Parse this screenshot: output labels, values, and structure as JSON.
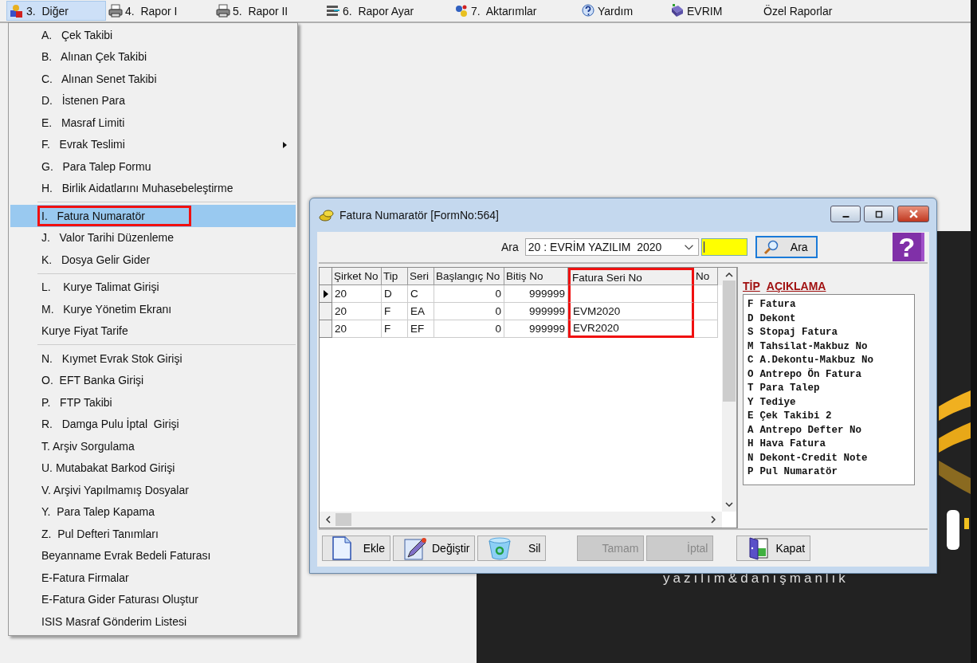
{
  "menubar": [
    {
      "label": "3.  Diğer",
      "selected": true
    },
    {
      "label": "4.  Rapor I",
      "selected": false
    },
    {
      "label": "5.  Rapor II",
      "selected": false
    },
    {
      "label": "6.  Rapor Ayar",
      "selected": false
    },
    {
      "label": "7.  Aktarımlar",
      "selected": false
    },
    {
      "label": "Yardım",
      "selected": false
    },
    {
      "label": "EVRIM",
      "selected": false
    },
    {
      "label": "Özel Raporlar",
      "selected": false
    }
  ],
  "dropdown": {
    "groups": [
      [
        {
          "label": "A.   Çek Takibi",
          "submenu": false,
          "selected": false
        },
        {
          "label": "B.   Alınan Çek Takibi",
          "submenu": false,
          "selected": false
        },
        {
          "label": "C.   Alınan Senet Takibi",
          "submenu": false,
          "selected": false
        },
        {
          "label": "D.   İstenen Para",
          "submenu": false,
          "selected": false
        },
        {
          "label": "E.   Masraf Limiti",
          "submenu": false,
          "selected": false
        },
        {
          "label": "F.   Evrak Teslimi",
          "submenu": true,
          "selected": false
        },
        {
          "label": "G.   Para Talep Formu",
          "submenu": false,
          "selected": false
        },
        {
          "label": "H.   Birlik Aidatlarını Muhasebeleştirme",
          "submenu": false,
          "selected": false
        }
      ],
      [
        {
          "label": "I.   Fatura Numaratör",
          "submenu": false,
          "selected": true
        },
        {
          "label": "J.   Valor Tarihi Düzenleme",
          "submenu": false,
          "selected": false
        },
        {
          "label": "K.   Dosya Gelir Gider",
          "submenu": false,
          "selected": false
        }
      ],
      [
        {
          "label": "L.    Kurye Talimat Girişi",
          "submenu": false,
          "selected": false
        },
        {
          "label": "M.   Kurye Yönetim Ekranı",
          "submenu": false,
          "selected": false
        },
        {
          "label": "Kurye Fiyat Tarife",
          "submenu": false,
          "selected": false
        }
      ],
      [
        {
          "label": "N.   Kıymet Evrak Stok Girişi",
          "submenu": false,
          "selected": false
        },
        {
          "label": "O.  EFT Banka Girişi",
          "submenu": false,
          "selected": false
        },
        {
          "label": "P.   FTP Takibi",
          "submenu": false,
          "selected": false
        },
        {
          "label": "R.   Damga Pulu İptal  Girişi",
          "submenu": false,
          "selected": false
        },
        {
          "label": "T. Arşiv Sorgulama",
          "submenu": false,
          "selected": false
        },
        {
          "label": "U. Mutabakat Barkod Girişi",
          "submenu": false,
          "selected": false
        },
        {
          "label": "V. Arşivi Yapılmamış Dosyalar",
          "submenu": false,
          "selected": false
        },
        {
          "label": "Y.  Para Talep Kapama",
          "submenu": false,
          "selected": false
        },
        {
          "label": "Z.  Pul Defteri Tanımları",
          "submenu": false,
          "selected": false
        },
        {
          "label": "Beyanname Evrak Bedeli Faturası",
          "submenu": false,
          "selected": false
        },
        {
          "label": "E-Fatura Firmalar",
          "submenu": false,
          "selected": false
        },
        {
          "label": "E-Fatura Gider Faturası Oluştur",
          "submenu": false,
          "selected": false
        },
        {
          "label": "ISIS Masraf Gönderim Listesi",
          "submenu": false,
          "selected": false
        }
      ]
    ]
  },
  "dialog": {
    "title": "Fatura Numaratör [FormNo:564]",
    "search": {
      "label": "Ara",
      "company": "20 : EVRİM YAZILIM  2020",
      "button": "Ara"
    },
    "help_mark": "?",
    "table": {
      "columns": [
        {
          "label": "Şirket No",
          "highlighted": false
        },
        {
          "label": "Tip",
          "highlighted": false
        },
        {
          "label": "Seri",
          "highlighted": false
        },
        {
          "label": "Başlangıç No",
          "highlighted": false
        },
        {
          "label": "Bitiş No",
          "highlighted": false
        },
        {
          "label": "Fatura Seri No",
          "highlighted": true
        },
        {
          "label": "No",
          "highlighted": false
        }
      ],
      "rows": [
        {
          "selected": true,
          "cells": [
            "20",
            "D",
            "C",
            "0",
            "999999",
            "",
            ""
          ]
        },
        {
          "selected": false,
          "cells": [
            "20",
            "F",
            "EA",
            "0",
            "999999",
            "EVM2020",
            ""
          ]
        },
        {
          "selected": false,
          "cells": [
            "20",
            "F",
            "EF",
            "0",
            "999999",
            "EVR2020",
            ""
          ]
        }
      ]
    },
    "legend": {
      "headers": [
        "TİP",
        "AÇIKLAMA"
      ],
      "items": [
        {
          "code": "F",
          "text": "Fatura"
        },
        {
          "code": "D",
          "text": "Dekont"
        },
        {
          "code": "S",
          "text": "Stopaj Fatura"
        },
        {
          "code": "M",
          "text": "Tahsilat-Makbuz No"
        },
        {
          "code": "C",
          "text": "A.Dekontu-Makbuz No"
        },
        {
          "code": "O",
          "text": "Antrepo Ön Fatura"
        },
        {
          "code": "T",
          "text": "Para Talep"
        },
        {
          "code": "Y",
          "text": "Tediye"
        },
        {
          "code": "E",
          "text": "Çek Takibi 2"
        },
        {
          "code": "A",
          "text": "Antrepo Defter No"
        },
        {
          "code": "H",
          "text": "Hava Fatura"
        },
        {
          "code": "N",
          "text": "Dekont-Credit Note"
        },
        {
          "code": "P",
          "text": "Pul Numaratör"
        }
      ]
    },
    "buttons": [
      {
        "label": "Ekle",
        "disabled": false
      },
      {
        "label": "Değiştir",
        "disabled": false
      },
      {
        "label": "Sil",
        "disabled": false
      },
      {
        "label": "Tamam",
        "disabled": true
      },
      {
        "label": "İptal",
        "disabled": true
      },
      {
        "label": "Kapat",
        "disabled": false
      }
    ]
  },
  "wallpaper": {
    "tagline": "yazılım&danışmanlık"
  }
}
